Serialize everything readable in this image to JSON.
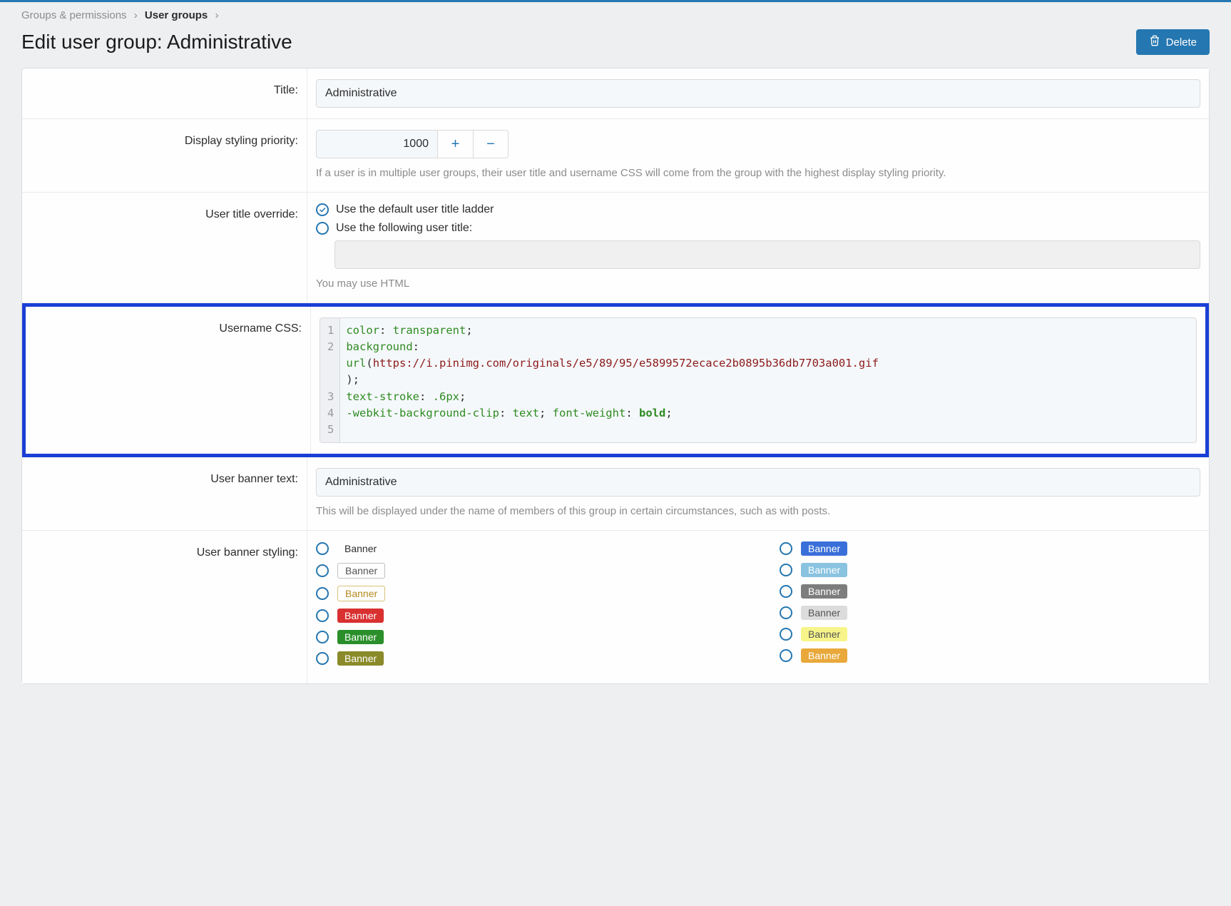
{
  "breadcrumb": {
    "item1": "Groups & permissions",
    "item2": "User groups"
  },
  "page_title": "Edit user group: Administrative",
  "delete_label": "Delete",
  "labels": {
    "title": "Title:",
    "priority": "Display styling priority:",
    "title_override": "User title override:",
    "username_css": "Username CSS:",
    "banner_text": "User banner text:",
    "banner_styling": "User banner styling:"
  },
  "fields": {
    "title_value": "Administrative",
    "priority_value": "1000",
    "priority_help": "If a user is in multiple user groups, their user title and username CSS will come from the group with the highest display styling priority.",
    "title_override_opt1": "Use the default user title ladder",
    "title_override_opt2": "Use the following user title:",
    "html_note": "You may use HTML",
    "banner_text_value": "Administrative",
    "banner_help": "This will be displayed under the name of members of this group in certain circumstances, such as with posts."
  },
  "code": {
    "line_numbers": "1\n2\n\n\n3\n4\n5",
    "l1_prop": "color",
    "l1_val": "transparent",
    "l2_prop": "background",
    "l2_url_kw": "url",
    "l2_url_val": "https://i.pinimg.com/originals/e5/89/95/e5899572ecace2b0895b36db7703a001.gif",
    "l3_close": ");",
    "l4_prop": "text-stroke",
    "l4_val": ".6px",
    "l5_prop": "-webkit-background-clip",
    "l5_val": "text",
    "l5_prop2": "font-weight",
    "l5_val2": "bold"
  },
  "banner_label": "Banner"
}
